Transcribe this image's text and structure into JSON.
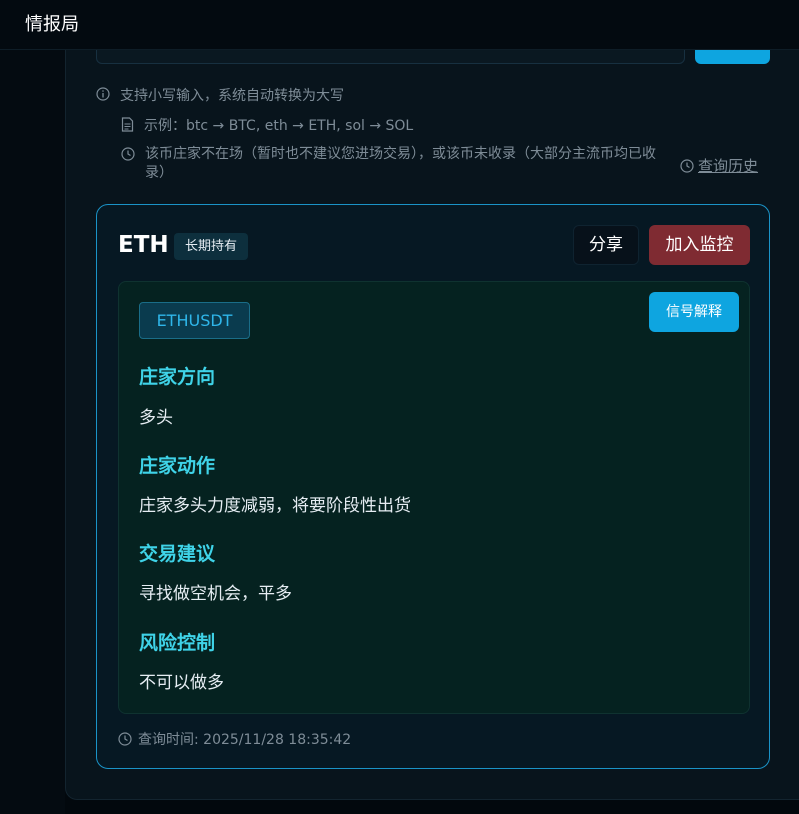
{
  "app": {
    "title": "情报局"
  },
  "hints": {
    "lowercase": "支持小写输入，系统自动转换为大写",
    "example": "示例：btc → BTC, eth → ETH, sol → SOL",
    "absent": "该币庄家不在场（暂时也不建议您进场交易），或该币未收录（大部分主流币均已收录）",
    "history": "查询历史"
  },
  "card": {
    "symbol": "ETH",
    "tag": "长期持有",
    "share_label": "分享",
    "monitor_label": "加入监控",
    "pair": "ETHUSDT",
    "explain_label": "信号解释",
    "sections": [
      {
        "title": "庄家方向",
        "value": "多头"
      },
      {
        "title": "庄家动作",
        "value": "庄家多头力度减弱，将要阶段性出货"
      },
      {
        "title": "交易建议",
        "value": "寻找做空机会，平多"
      },
      {
        "title": "风险控制",
        "value": "不可以做多"
      }
    ],
    "query_time": "查询时间: 2025/11/28 18:35:42"
  },
  "colors": {
    "accent": "#0ea5e0",
    "danger": "#7f2b32",
    "section_title": "#3fd3e8",
    "card_border": "#1a93c7"
  },
  "icons": [
    "info-icon",
    "document-icon",
    "clock-icon",
    "history-clock-icon",
    "time-clock-icon"
  ]
}
